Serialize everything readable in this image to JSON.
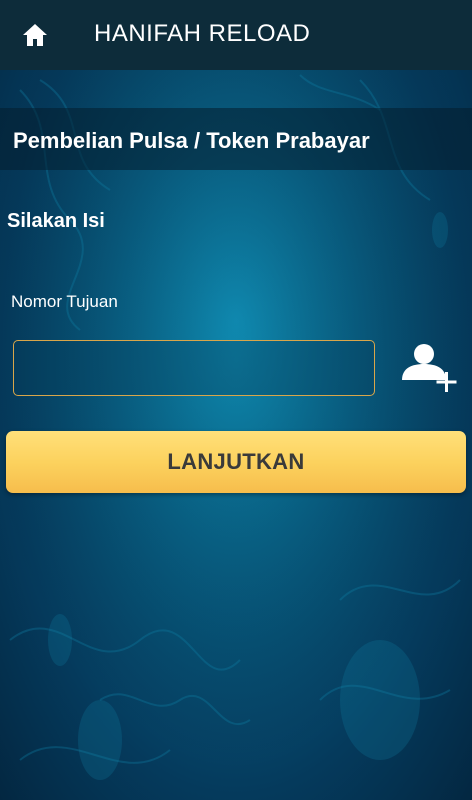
{
  "appbar": {
    "title": "HANIFAH RELOAD",
    "home_icon": "home-icon"
  },
  "section": {
    "title": "Pembelian Pulsa / Token Prabayar"
  },
  "form": {
    "prompt": "Silakan Isi",
    "field_label": "Nomor Tujuan",
    "field_value": "",
    "field_placeholder": "",
    "contact_icon": "add-contact-icon",
    "submit_label": "LANJUTKAN"
  },
  "colors": {
    "appbar_bg": "#0d2c3a",
    "background": "#075c82",
    "input_border": "#d9a64a",
    "button_gradient_top": "#ffe07a",
    "button_gradient_bottom": "#f6bd4c",
    "button_text": "#3a3a3a"
  }
}
